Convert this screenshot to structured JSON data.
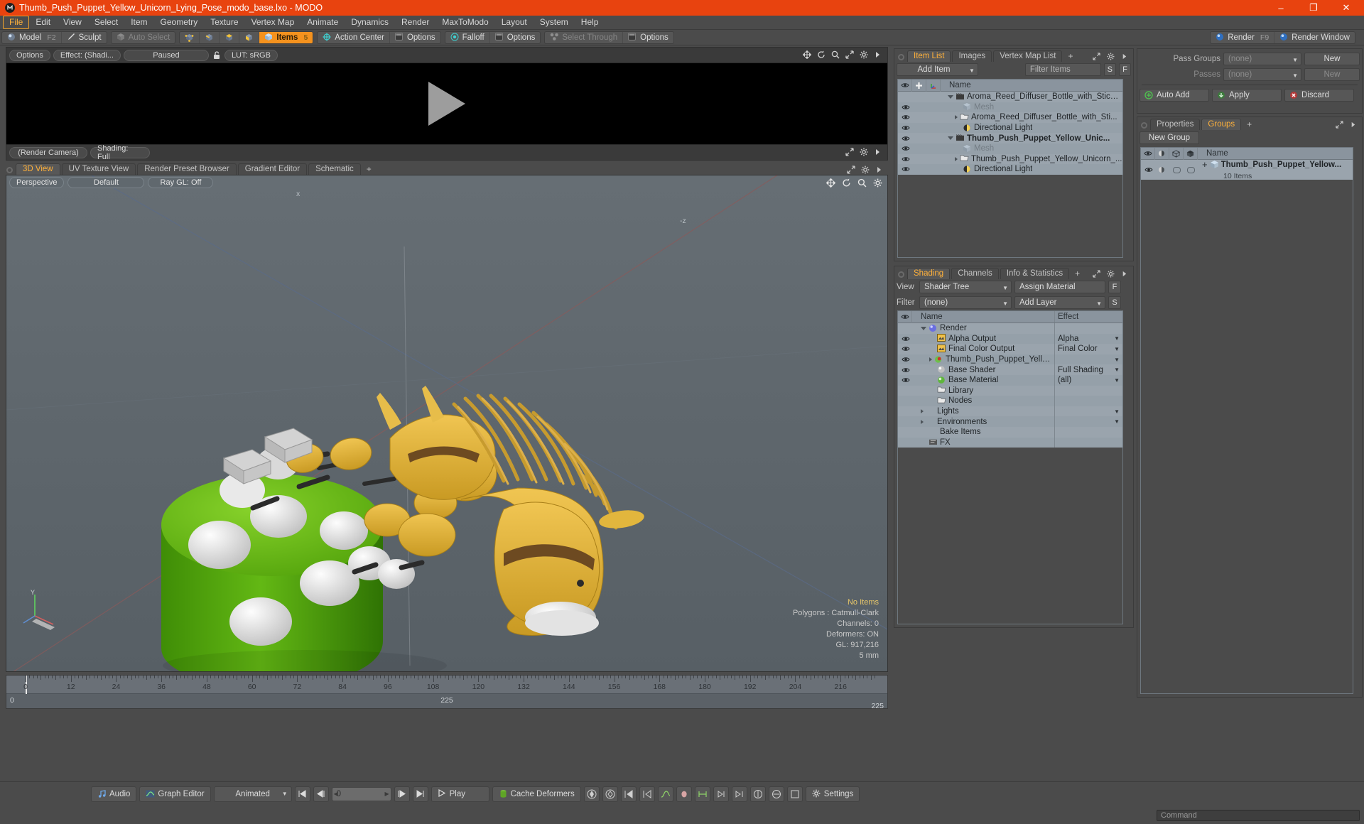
{
  "window": {
    "title": "Thumb_Push_Puppet_Yellow_Unicorn_Lying_Pose_modo_base.lxo - MODO",
    "minimize": "–",
    "maximize": "❐",
    "close": "✕"
  },
  "menubar": [
    {
      "label": "File",
      "active": true
    },
    {
      "label": "Edit"
    },
    {
      "label": "View"
    },
    {
      "label": "Select"
    },
    {
      "label": "Item"
    },
    {
      "label": "Geometry"
    },
    {
      "label": "Texture"
    },
    {
      "label": "Vertex Map"
    },
    {
      "label": "Animate"
    },
    {
      "label": "Dynamics"
    },
    {
      "label": "Render"
    },
    {
      "label": "MaxToModo"
    },
    {
      "label": "Layout"
    },
    {
      "label": "System"
    },
    {
      "label": "Help"
    }
  ],
  "modebar": {
    "model": "Model",
    "model_key": "F2",
    "sculpt": "Sculpt",
    "auto_select": "Auto Select",
    "items": "Items",
    "items_key": "5",
    "action_center": "Action Center",
    "options1": "Options",
    "falloff": "Falloff",
    "options2": "Options",
    "select_through": "Select Through",
    "options3": "Options",
    "render": "Render",
    "render_key": "F9",
    "render_window": "Render Window"
  },
  "render_preview": {
    "options": "Options",
    "effect": "Effect: (Shadi...",
    "paused": "Paused",
    "lut": "LUT: sRGB",
    "render_camera": "(Render Camera)",
    "shading": "Shading: Full"
  },
  "viewport_tabs": [
    {
      "label": "3D View",
      "selected": true
    },
    {
      "label": "UV Texture View"
    },
    {
      "label": "Render Preset Browser"
    },
    {
      "label": "Gradient Editor"
    },
    {
      "label": "Schematic"
    },
    {
      "label": "+"
    }
  ],
  "viewport": {
    "projection": "Perspective",
    "style": "Default",
    "raygl": "Ray GL: Off",
    "axis_z": "-z",
    "axis_x": "x",
    "axis_y": "Y",
    "stats": {
      "no_items": "No Items",
      "polygons": "Polygons : Catmull-Clark",
      "channels": "Channels: 0",
      "deformers": "Deformers: ON",
      "gl": "GL: 917,216",
      "scale": "5 mm"
    }
  },
  "timeline": {
    "ticks": [
      0,
      12,
      24,
      36,
      48,
      60,
      72,
      84,
      96,
      108,
      120,
      132,
      144,
      156,
      168,
      180,
      192,
      204,
      216
    ],
    "range_start": "0",
    "range_end": "225",
    "range_end_right": "225",
    "current_frame": "0"
  },
  "bottombar": {
    "audio": "Audio",
    "graph_editor": "Graph Editor",
    "animated": "Animated",
    "frame_value": "0",
    "play": "Play",
    "cache_deformers": "Cache Deformers",
    "settings": "Settings"
  },
  "item_list": {
    "tabs": [
      {
        "label": "Item List",
        "selected": true
      },
      {
        "label": "Images"
      },
      {
        "label": "Vertex Map List"
      },
      {
        "label": "+"
      }
    ],
    "add_item": "Add Item",
    "filter_placeholder": "Filter Items",
    "btn_s": "S",
    "btn_f": "F",
    "col_name": "Name",
    "rows": [
      {
        "label": "Aroma_Reed_Diffuser_Bottle_with_Stick ...",
        "indent": 1,
        "icon": "scene-icon",
        "toggle": "down",
        "eye": false,
        "bold": false,
        "muted": false
      },
      {
        "label": "Mesh",
        "indent": 2,
        "icon": "mesh-icon",
        "toggle": "none",
        "eye": true,
        "bold": false,
        "muted": true
      },
      {
        "label": "Aroma_Reed_Diffuser_Bottle_with_Sti...",
        "indent": 2,
        "icon": "folder-icon",
        "toggle": "right",
        "eye": true,
        "bold": false,
        "muted": false
      },
      {
        "label": "Directional Light",
        "indent": 2,
        "icon": "light-icon",
        "toggle": "none",
        "eye": true,
        "bold": false,
        "muted": false
      },
      {
        "label": "Thumb_Push_Puppet_Yellow_Unic...",
        "indent": 1,
        "icon": "scene-icon",
        "toggle": "down",
        "eye": true,
        "bold": true,
        "muted": false
      },
      {
        "label": "Mesh",
        "indent": 2,
        "icon": "mesh-icon",
        "toggle": "none",
        "eye": true,
        "bold": false,
        "muted": true
      },
      {
        "label": "Thumb_Push_Puppet_Yellow_Unicorn_...",
        "indent": 2,
        "icon": "folder-icon",
        "toggle": "right",
        "eye": true,
        "bold": false,
        "muted": false
      },
      {
        "label": "Directional Light",
        "indent": 2,
        "icon": "light-icon",
        "toggle": "none",
        "eye": true,
        "bold": false,
        "muted": false
      }
    ]
  },
  "shading": {
    "tabs": [
      {
        "label": "Shading",
        "selected": true
      },
      {
        "label": "Channels"
      },
      {
        "label": "Info & Statistics"
      },
      {
        "label": "+"
      }
    ],
    "view_label": "View",
    "view_value": "Shader Tree",
    "assign_material": "Assign Material",
    "btn_f": "F",
    "filter_label": "Filter",
    "filter_value": "(none)",
    "add_layer": "Add Layer",
    "btn_s": "S",
    "col_name": "Name",
    "col_effect": "Effect",
    "rows": [
      {
        "label": "Render",
        "effect": "",
        "indent": 1,
        "icon": "render-globe-icon",
        "toggle": "down",
        "eye": false
      },
      {
        "label": "Alpha Output",
        "effect": "Alpha",
        "indent": 2,
        "icon": "output-icon",
        "toggle": "none",
        "eye": true
      },
      {
        "label": "Final Color Output",
        "effect": "Final Color",
        "indent": 2,
        "icon": "output-icon",
        "toggle": "none",
        "eye": true
      },
      {
        "label": "Thumb_Push_Puppet_Yello ...",
        "effect": "",
        "indent": 2,
        "icon": "material-group-icon",
        "toggle": "right",
        "eye": true
      },
      {
        "label": "Base Shader",
        "effect": "Full Shading",
        "indent": 2,
        "icon": "shader-icon",
        "toggle": "none",
        "eye": true
      },
      {
        "label": "Base Material",
        "effect": "(all)",
        "indent": 2,
        "icon": "material-icon",
        "toggle": "none",
        "eye": true
      },
      {
        "label": "Library",
        "effect": "",
        "indent": 2,
        "icon": "folder-icon",
        "toggle": "none",
        "eye": false
      },
      {
        "label": "Nodes",
        "effect": "",
        "indent": 2,
        "icon": "folder-icon",
        "toggle": "none",
        "eye": false
      },
      {
        "label": "Lights",
        "effect": "",
        "indent": 1,
        "icon": "none",
        "toggle": "right",
        "eye": false
      },
      {
        "label": "Environments",
        "effect": "",
        "indent": 1,
        "icon": "none",
        "toggle": "right",
        "eye": false
      },
      {
        "label": "Bake Items",
        "effect": "",
        "indent": 1,
        "icon": "none",
        "toggle": "none",
        "eye": false
      },
      {
        "label": "FX",
        "effect": "",
        "indent": 1,
        "icon": "fx-icon",
        "toggle": "none",
        "eye": false
      }
    ]
  },
  "passes": {
    "pass_groups_label": "Pass Groups",
    "pass_groups_value": "(none)",
    "pass_groups_new": "New",
    "passes_label": "Passes",
    "passes_value": "(none)",
    "passes_new": "New",
    "auto_add": "Auto Add",
    "apply": "Apply",
    "discard": "Discard"
  },
  "groups": {
    "tabs": [
      {
        "label": "Properties"
      },
      {
        "label": "Groups",
        "selected": true
      },
      {
        "label": "+"
      }
    ],
    "new_group": "New Group",
    "col_name": "Name",
    "rows": [
      {
        "label": "Thumb_Push_Puppet_Yellow...",
        "sub": "10 Items"
      }
    ]
  },
  "command": {
    "placeholder": "Command"
  },
  "colors": {
    "title_bar": "#e8430f",
    "accent": "#f4921e",
    "panel": "#4b4b4b",
    "list_bg": "#9aa4ad",
    "viewport_bg": "#5e666b"
  }
}
